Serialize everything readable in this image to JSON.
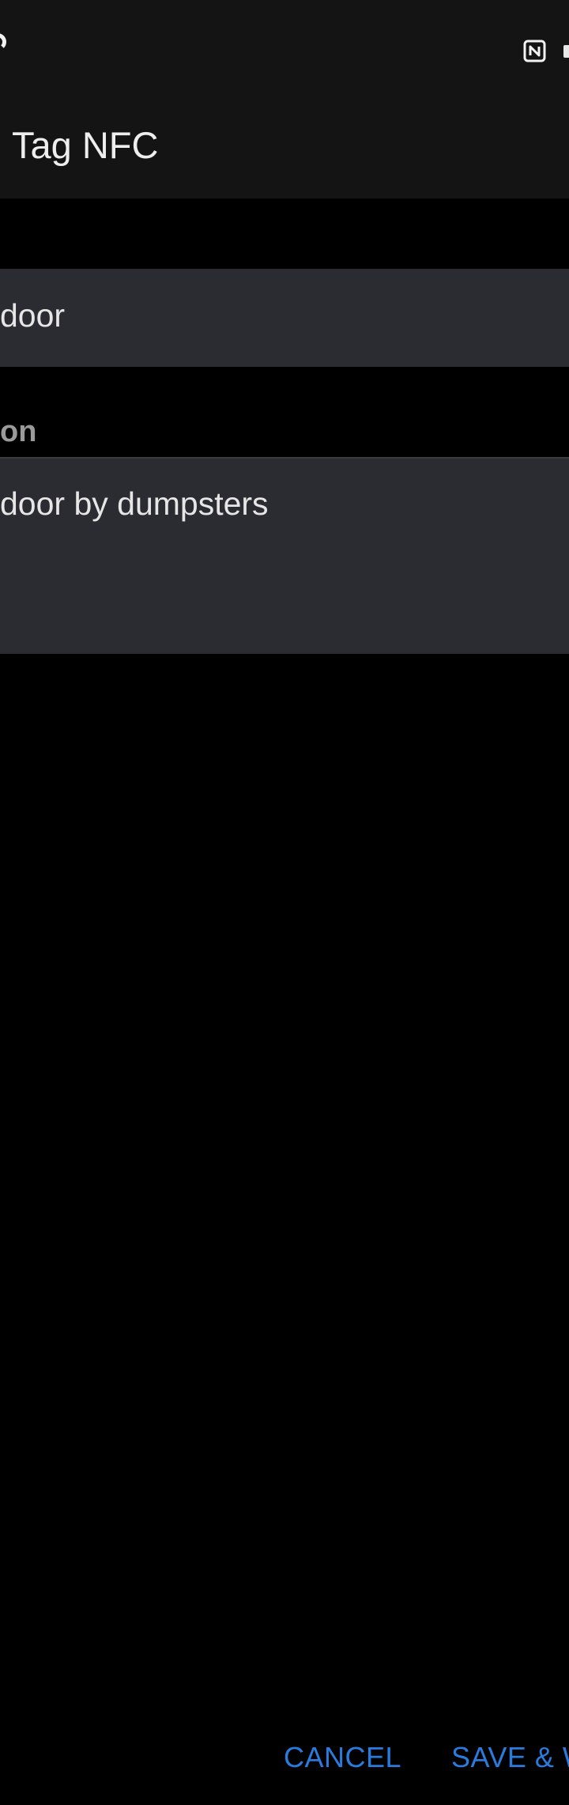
{
  "status_bar": {
    "left_icon": "signal-partial-icon",
    "right_icons": [
      "nfc-icon",
      "battery-icon"
    ]
  },
  "app_bar": {
    "title": "Tag NFC"
  },
  "form": {
    "name_field": {
      "value": "door"
    },
    "description_label": "on",
    "description_field": {
      "value": "door by dumpsters"
    }
  },
  "actions": {
    "cancel_label": "CANCEL",
    "save_label": "SAVE & W"
  },
  "colors": {
    "background": "#000000",
    "toolbar": "#141414",
    "field": "#2a2c31",
    "accent": "#2a7bde",
    "text": "#e6e6e6",
    "label": "#9a9a9a"
  }
}
